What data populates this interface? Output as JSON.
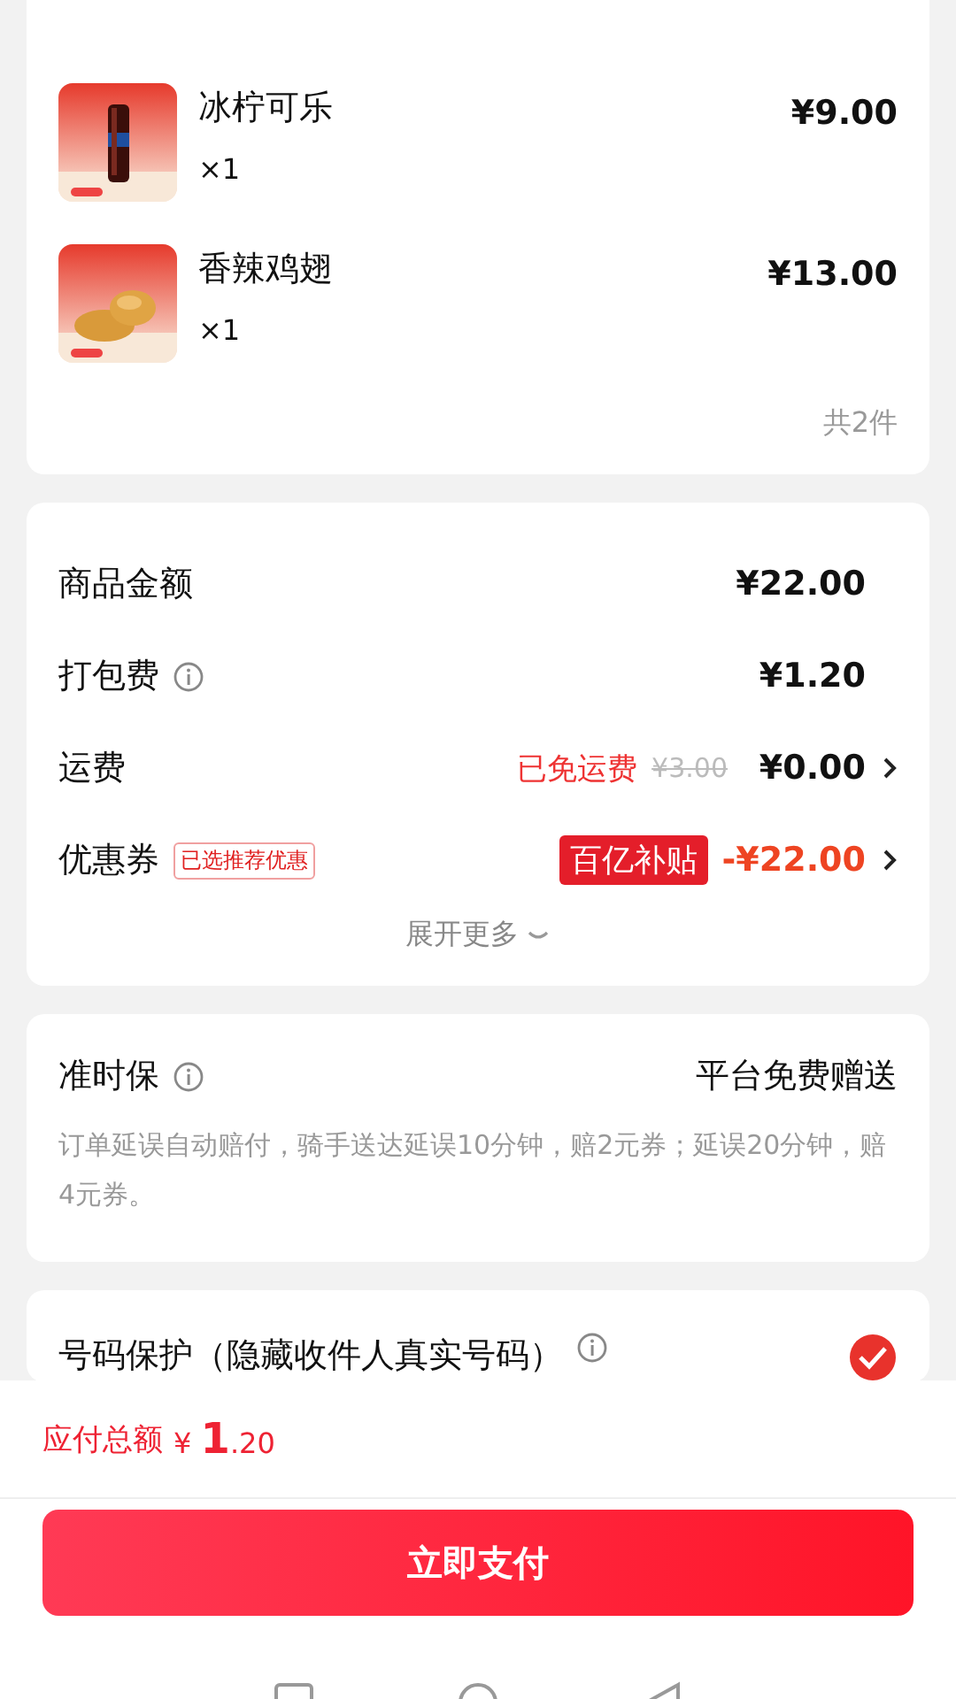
{
  "order_items": [
    {
      "name": "冰柠可乐",
      "qty": "×1",
      "price": "¥9.00",
      "kind": "drink"
    },
    {
      "name": "香辣鸡翅",
      "qty": "×1",
      "price": "¥13.00",
      "kind": "food"
    }
  ],
  "item_count": "共2件",
  "fees": [
    {
      "label": "商品金额",
      "info": false,
      "amount": "¥22.00",
      "arrow": false
    },
    {
      "label": "打包费",
      "info": true,
      "amount": "¥1.20",
      "arrow": false
    },
    {
      "label": "运费",
      "info": false,
      "note": "已免运费",
      "original": "¥3.00",
      "amount": "¥0.00",
      "arrow": true
    },
    {
      "label": "优惠券",
      "info": false,
      "tag": "已选推荐优惠",
      "badge": "百亿补贴",
      "amount": "-¥22.00",
      "discount": true,
      "arrow": true
    }
  ],
  "expand_more": "展开更多",
  "guarantee": {
    "title": "准时保",
    "value": "平台免费赠送",
    "description": "订单延误自动赔付，骑手送达延误10分钟，赔2元券；延误20分钟，赔4元券。"
  },
  "number_protection": {
    "title": "号码保护（隐藏收件人真实号码）",
    "checked": true
  },
  "total": {
    "label": "应付总额",
    "currency": "¥",
    "integer": "1",
    "decimal": ".20"
  },
  "pay_button": "立即支付"
}
